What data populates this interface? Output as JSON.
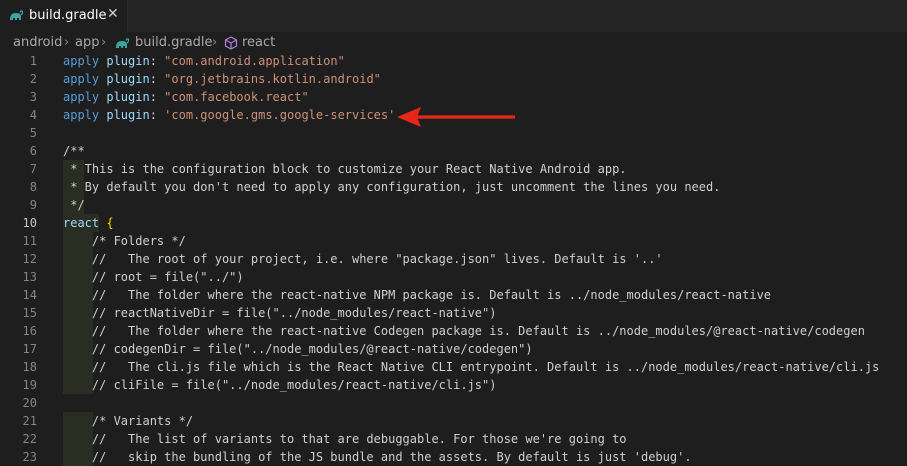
{
  "tab": {
    "label": "build.gradle",
    "close": "✕",
    "icon": "gradle-elephant-icon"
  },
  "breadcrumb": {
    "items": [
      "android",
      "app",
      "build.gradle",
      "react"
    ],
    "separator": "›"
  },
  "code_lines": [
    {
      "n": "1",
      "parts": [
        [
          "apply",
          "kw-apply"
        ],
        [
          " ",
          ""
        ],
        [
          "plugin",
          "kw-plugin"
        ],
        [
          ": ",
          ""
        ],
        [
          "\"com.android.application\"",
          "str"
        ]
      ]
    },
    {
      "n": "2",
      "parts": [
        [
          "apply",
          "kw-apply"
        ],
        [
          " ",
          ""
        ],
        [
          "plugin",
          "kw-plugin"
        ],
        [
          ": ",
          ""
        ],
        [
          "\"org.jetbrains.kotlin.android\"",
          "str"
        ]
      ]
    },
    {
      "n": "3",
      "parts": [
        [
          "apply",
          "kw-apply"
        ],
        [
          " ",
          ""
        ],
        [
          "plugin",
          "kw-plugin"
        ],
        [
          ": ",
          ""
        ],
        [
          "\"com.facebook.react\"",
          "str"
        ]
      ]
    },
    {
      "n": "4",
      "parts": [
        [
          "apply",
          "kw-apply"
        ],
        [
          " ",
          ""
        ],
        [
          "plugin",
          "kw-plugin"
        ],
        [
          ": ",
          ""
        ],
        [
          "'com.google.gms.google-services'",
          "str"
        ]
      ]
    },
    {
      "n": "5",
      "parts": []
    },
    {
      "n": "6",
      "parts": [
        [
          "/**",
          "cmt"
        ]
      ]
    },
    {
      "n": "7",
      "parts": [
        [
          " * This is the configuration block to customize your React Native Android app.",
          "cmt"
        ]
      ]
    },
    {
      "n": "8",
      "parts": [
        [
          " * By default you don't need to apply any configuration, just uncomment the lines you need.",
          "cmt"
        ]
      ]
    },
    {
      "n": "9",
      "parts": [
        [
          " */",
          "cmt"
        ]
      ]
    },
    {
      "n": "10",
      "parts": [
        [
          "react",
          "kw-react"
        ],
        [
          " ",
          ""
        ],
        [
          "{",
          "brace"
        ]
      ]
    },
    {
      "n": "11",
      "parts": [
        [
          "    /* Folders */",
          "cmt"
        ]
      ]
    },
    {
      "n": "12",
      "parts": [
        [
          "    //   The root of your project, i.e. where \"package.json\" lives. Default is '..'",
          "cmt"
        ]
      ]
    },
    {
      "n": "13",
      "parts": [
        [
          "    // root = file(\"../\")",
          "cmt"
        ]
      ]
    },
    {
      "n": "14",
      "parts": [
        [
          "    //   The folder where the react-native NPM package is. Default is ../node_modules/react-native",
          "cmt"
        ]
      ]
    },
    {
      "n": "15",
      "parts": [
        [
          "    // reactNativeDir = file(\"../node_modules/react-native\")",
          "cmt"
        ]
      ]
    },
    {
      "n": "16",
      "parts": [
        [
          "    //   The folder where the react-native Codegen package is. Default is ../node_modules/@react-native/codegen",
          "cmt"
        ]
      ]
    },
    {
      "n": "17",
      "parts": [
        [
          "    // codegenDir = file(\"../node_modules/@react-native/codegen\")",
          "cmt"
        ]
      ]
    },
    {
      "n": "18",
      "parts": [
        [
          "    //   The cli.js file which is the React Native CLI entrypoint. Default is ../node_modules/react-native/cli.js",
          "cmt"
        ]
      ]
    },
    {
      "n": "19",
      "parts": [
        [
          "    // cliFile = file(\"../node_modules/react-native/cli.js\")",
          "cmt"
        ]
      ]
    },
    {
      "n": "20",
      "parts": []
    },
    {
      "n": "21",
      "parts": [
        [
          "    /* Variants */",
          "cmt"
        ]
      ]
    },
    {
      "n": "22",
      "parts": [
        [
          "    //   The list of variants to that are debuggable. For those we're going to",
          "cmt"
        ]
      ]
    },
    {
      "n": "23",
      "parts": [
        [
          "    //   skip the bundling of the JS bundle and the assets. By default is just 'debug'.",
          "cmt"
        ]
      ]
    }
  ],
  "annotation": {
    "color": "#e8251b"
  }
}
